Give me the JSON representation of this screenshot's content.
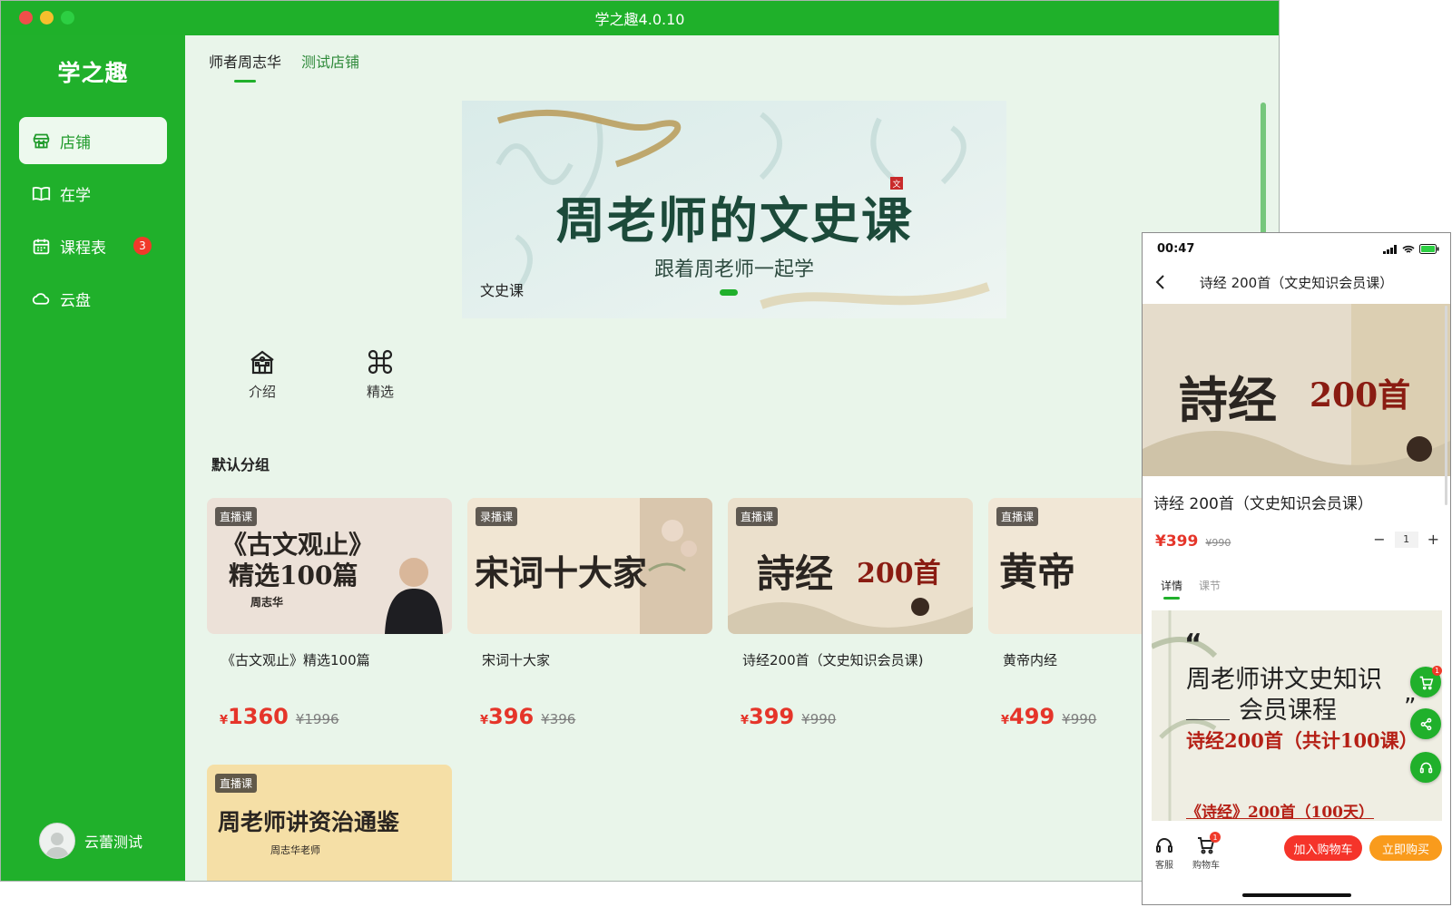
{
  "window": {
    "title": "学之趣4.0.10"
  },
  "sidebar": {
    "brand": "学之趣",
    "items": [
      {
        "label": "店铺",
        "icon": "store-icon",
        "active": true
      },
      {
        "label": "在学",
        "icon": "book-icon"
      },
      {
        "label": "课程表",
        "icon": "calendar-icon",
        "badge": "3"
      },
      {
        "label": "云盘",
        "icon": "cloud-icon"
      }
    ],
    "user": {
      "name": "云蕾测试"
    }
  },
  "shop_tabs": [
    {
      "label": "师者周志华",
      "active": true
    },
    {
      "label": "测试店铺"
    }
  ],
  "banner": {
    "title": "周老师的文史课",
    "subtitle": "跟着周老师一起学",
    "label": "文史课",
    "seal": "文"
  },
  "quick_links": [
    {
      "label": "介绍",
      "icon": "school-icon"
    },
    {
      "label": "精选",
      "icon": "command-icon"
    }
  ],
  "group": {
    "title": "默认分组"
  },
  "courses": [
    {
      "tag": "直播课",
      "title": "《古文观止》精选100篇",
      "price": "1360",
      "old_price": "¥1996",
      "img_line1": "《古文观止》",
      "img_line2": "精选100篇",
      "img_author": "周志华"
    },
    {
      "tag": "录播课",
      "title": "宋词十大家",
      "price": "396",
      "old_price": "¥396",
      "img_text": "宋词十大家"
    },
    {
      "tag": "直播课",
      "title": "诗经200首（文史知识会员课)",
      "price": "399",
      "old_price": "¥990",
      "img_text": "詩经",
      "img_num": "200首"
    },
    {
      "tag": "直播课",
      "title": "黄帝内经",
      "price": "499",
      "old_price": "¥990",
      "img_text": "黄帝"
    },
    {
      "tag": "直播课",
      "title": "",
      "price": "",
      "old_price": "",
      "img_text": "周老师讲资治通鉴",
      "img_author": "周志华老师"
    }
  ],
  "currency": "¥",
  "phone": {
    "time": "00:47",
    "nav_title": "诗经 200首（文史知识会员课）",
    "hero_text": "詩经",
    "hero_num": "200首",
    "product_name": "诗经 200首（文史知识会员课）",
    "price": "¥399",
    "old_price": "¥990",
    "quantity": "1",
    "tabs": [
      {
        "label": "详情",
        "active": true
      },
      {
        "label": "课节"
      }
    ],
    "detail": {
      "line1": "周老师讲文史知识",
      "line2": "会员课程",
      "line3": "诗经200首（共计100课）",
      "line4": "《诗经》200首（100天）",
      "quote_left": "“",
      "quote_right": "”"
    },
    "cart_badge": "1",
    "bottom": {
      "service_label": "客服",
      "cart_label": "购物车",
      "cart_badge": "1",
      "add_cart": "加入购物车",
      "buy_now": "立即购买"
    }
  },
  "colors": {
    "primary": "#20b02b",
    "price": "#e5352a",
    "buy": "#f99b1c"
  }
}
